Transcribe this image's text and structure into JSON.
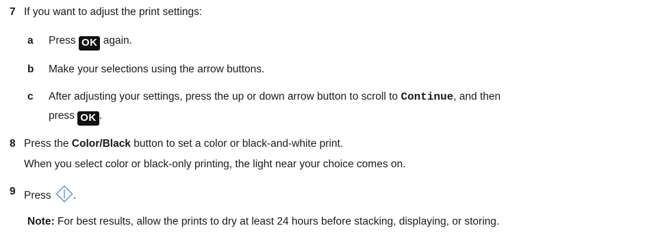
{
  "step7": {
    "number": "7",
    "text": "If you want to adjust the print settings:",
    "sub_a": {
      "letter": "a",
      "before": "Press",
      "key": "OK",
      "after": "again."
    },
    "sub_b": {
      "letter": "b",
      "text": "Make your selections using the arrow buttons."
    },
    "sub_c": {
      "letter": "c",
      "before": "After adjusting your settings, press the up or down arrow button to scroll to",
      "code": "Continue",
      "after": ", and then",
      "line2_before": "press",
      "key": "OK",
      "line2_after": "."
    }
  },
  "step8": {
    "number": "8",
    "before": "Press the",
    "button_name": "Color/Black",
    "after": "button to set a color or black-and-white print.",
    "detail": "When you select color or black-only printing, the light near your choice comes on."
  },
  "step9": {
    "number": "9",
    "before": "Press",
    "icon": "start-icon",
    "after": "."
  },
  "note": {
    "label": "Note:",
    "text": "For best results, allow the prints to dry at least 24 hours before stacking, displaying, or storing."
  }
}
